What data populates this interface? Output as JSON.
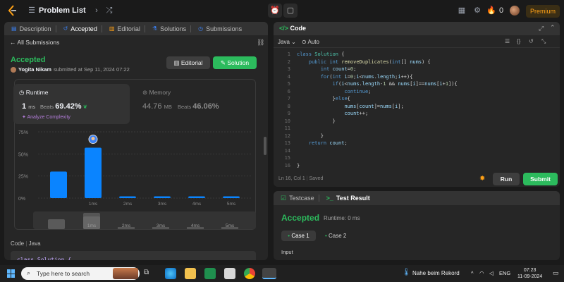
{
  "topbar": {
    "title": "Problem List",
    "premium_label": "Premium",
    "streak_count": "0"
  },
  "left_panel": {
    "tabs": [
      {
        "label": "Description",
        "icon": "description-icon"
      },
      {
        "label": "Accepted",
        "icon": "history-icon"
      },
      {
        "label": "Editorial",
        "icon": "book-icon"
      },
      {
        "label": "Solutions",
        "icon": "flask-icon"
      },
      {
        "label": "Submissions",
        "icon": "clock-icon"
      }
    ],
    "all_submissions": "All Submissions",
    "status": "Accepted",
    "user": "Yogita Nikam",
    "submitted_text": "submitted at Sep 11, 2024 07:22",
    "editorial_button": "Editorial",
    "solution_button": "Solution",
    "runtime": {
      "title": "Runtime",
      "value": "1",
      "unit": "ms",
      "beats_label": "Beats",
      "beats_value": "69.42%",
      "analyze_label": "Analyze Complexity"
    },
    "memory": {
      "title": "Memory",
      "value": "44.76",
      "unit": "MB",
      "beats_label": "Beats",
      "beats_value": "46.06%"
    },
    "code_label": "Code",
    "code_language": "Java",
    "code_preview": "class Solution {"
  },
  "chart_data": {
    "type": "bar",
    "categories": [
      "",
      "1ms",
      "2ms",
      "3ms",
      "4ms",
      "5ms"
    ],
    "values": [
      30,
      57,
      2,
      2,
      2,
      2
    ],
    "highlight_index": 1,
    "yticks": [
      "75%",
      "50%",
      "25%",
      "0%"
    ],
    "ylim": [
      0,
      75
    ],
    "bar_color": "#0a84ff",
    "mini_labels": [
      "1ms",
      "2ms",
      "3ms",
      "4ms",
      "5ms"
    ]
  },
  "editor": {
    "title": "Code",
    "language": "Java",
    "auto": "Auto",
    "status_position": "Ln 16, Col 1",
    "status_saved": "Saved",
    "run_label": "Run",
    "submit_label": "Submit",
    "lines": [
      "class Solution {",
      "    public int removeDuplicates(int[] nums) {",
      "        int count=0;",
      "        for(int i=0;i<nums.length;i++){",
      "            if(i<nums.length-1 && nums[i]==nums[i+1]){",
      "                continue;",
      "            }else{",
      "                nums[count]=nums[i];",
      "                count++;",
      "            }",
      "",
      "        }",
      "    return count;",
      "",
      "",
      "}"
    ]
  },
  "testcase": {
    "tab_testcase": "Testcase",
    "tab_result": "Test Result",
    "status": "Accepted",
    "runtime": "Runtime: 0 ms",
    "case1": "Case 1",
    "case2": "Case 2",
    "input_label": "Input"
  },
  "taskbar": {
    "search_placeholder": "Type here to search",
    "weather": "Nahe beim Rekord",
    "lang": "ENG",
    "time": "07:23",
    "date": "11-09-2024"
  }
}
